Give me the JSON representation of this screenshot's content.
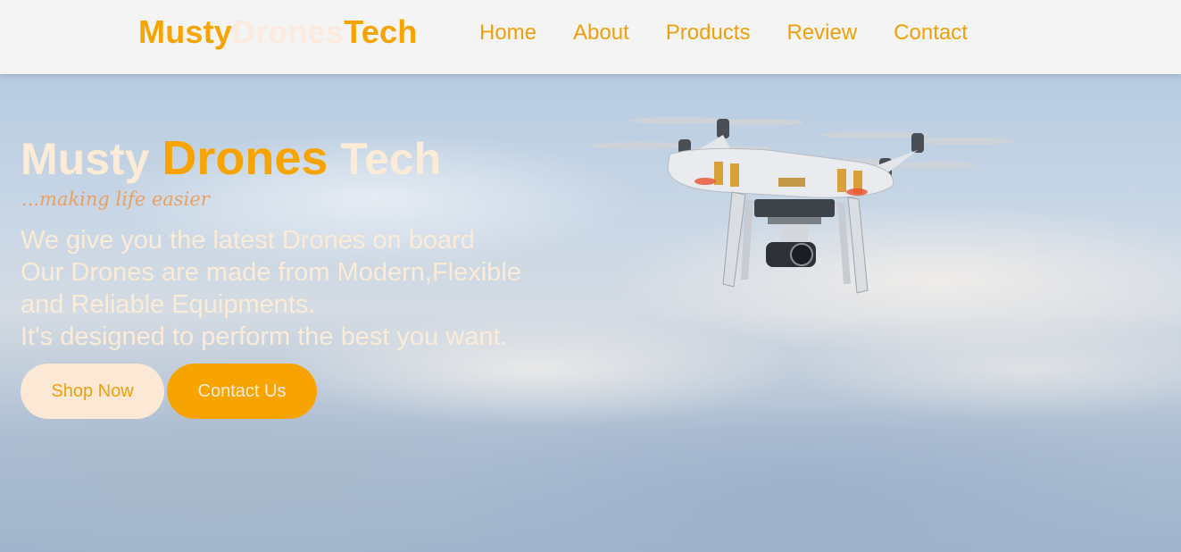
{
  "colors": {
    "accent": "#f8a400",
    "cream": "#fcebd7",
    "nav_bg": "#f4f4f4",
    "tagline": "#e8a060"
  },
  "navbar": {
    "logo": {
      "part1": "Musty",
      "part2": "Drones",
      "part3": "Tech"
    },
    "links": [
      {
        "label": "Home"
      },
      {
        "label": "About"
      },
      {
        "label": "Products"
      },
      {
        "label": "Review"
      },
      {
        "label": "Contact"
      }
    ]
  },
  "hero": {
    "title": {
      "part1": "Musty ",
      "part2": "Drones",
      "part3": " Tech"
    },
    "tagline": "...making life easier",
    "lines": [
      "We give you the latest Drones on board",
      "Our Drones are made from Modern,Flexible",
      "and Reliable Equipments.",
      "It's designed to perform the best you want."
    ],
    "buttons": {
      "shop": "Shop Now",
      "contact": "Contact Us"
    },
    "image": {
      "icon": "quadcopter-drone-image"
    }
  }
}
